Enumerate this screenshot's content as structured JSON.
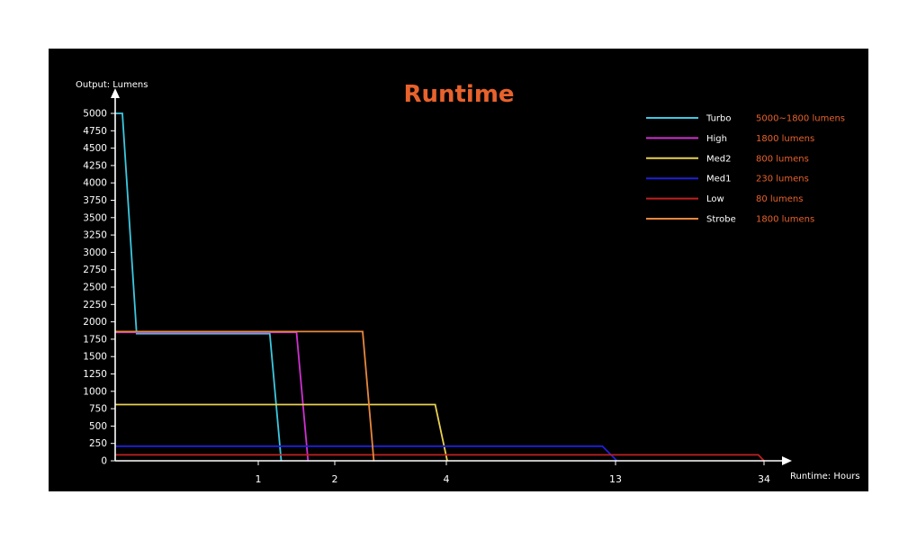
{
  "colors": {
    "background": "#000000",
    "axis": "#ffffff",
    "title": "#e8622c",
    "legend_value": "#e8622c",
    "text": "#ffffff"
  },
  "chart_data": {
    "type": "line",
    "title": "Runtime",
    "ylabel": "Output: Lumens",
    "xlabel": "Runtime: Hours",
    "ylim": [
      0,
      5000
    ],
    "yticks": [
      0,
      250,
      500,
      750,
      1000,
      1250,
      1500,
      1750,
      2000,
      2250,
      2500,
      2750,
      3000,
      3250,
      3500,
      3750,
      4000,
      4250,
      4500,
      4750,
      5000
    ],
    "xtick_labels": [
      "1",
      "2",
      "4",
      "13",
      "34"
    ],
    "x_scale": "non-uniform (log-like)",
    "grid": false,
    "legend_position": "top-right",
    "series": [
      {
        "name": "Turbo",
        "value_label": "5000~1800 lumens",
        "color": "#3cc8e0",
        "points": [
          [
            0,
            5000
          ],
          [
            0.05,
            5000
          ],
          [
            0.15,
            1830
          ],
          [
            1.15,
            1830
          ],
          [
            1.3,
            0
          ]
        ]
      },
      {
        "name": "High",
        "value_label": "1800 lumens",
        "color": "#d030d0",
        "points": [
          [
            0,
            1850
          ],
          [
            1.5,
            1850
          ],
          [
            1.65,
            0
          ]
        ]
      },
      {
        "name": "Med2",
        "value_label": "800 lumens",
        "color": "#e8d050",
        "points": [
          [
            0,
            810
          ],
          [
            3.8,
            810
          ],
          [
            4.05,
            0
          ]
        ]
      },
      {
        "name": "Med1",
        "value_label": "230 lumens",
        "color": "#2020d8",
        "points": [
          [
            0,
            210
          ],
          [
            12.3,
            210
          ],
          [
            13.2,
            0
          ]
        ]
      },
      {
        "name": "Low",
        "value_label": "80 lumens",
        "color": "#c02020",
        "points": [
          [
            0,
            85
          ],
          [
            33.2,
            85
          ],
          [
            34,
            0
          ]
        ]
      },
      {
        "name": "Strobe",
        "value_label": "1800 lumens",
        "color": "#e8883c",
        "points": [
          [
            0,
            1860
          ],
          [
            2.5,
            1860
          ],
          [
            2.7,
            0
          ]
        ]
      }
    ]
  }
}
